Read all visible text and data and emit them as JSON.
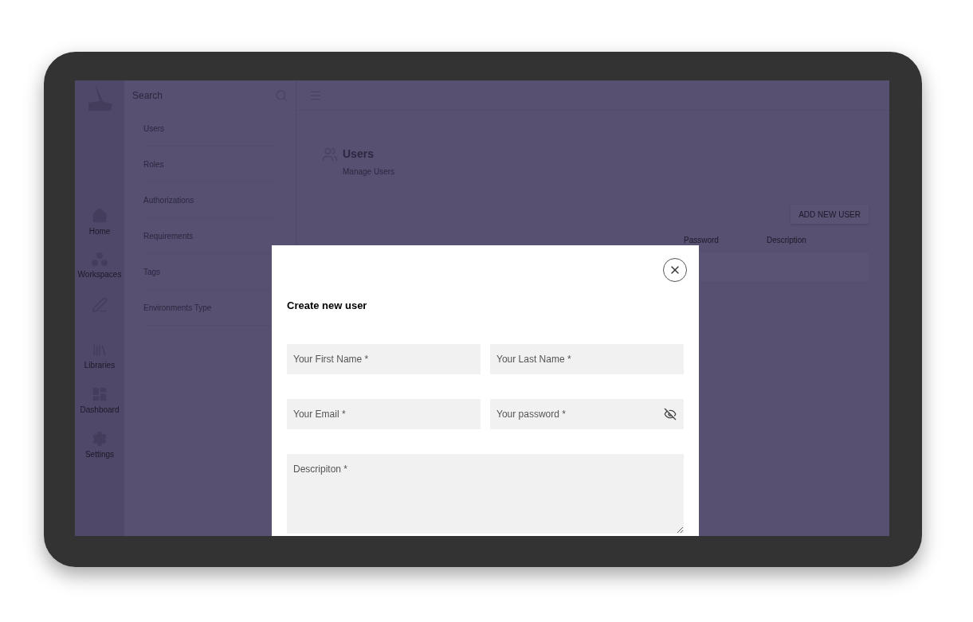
{
  "sidebar": {
    "search": {
      "placeholder": "Search"
    },
    "items": [
      {
        "label": "Users"
      },
      {
        "label": "Roles"
      },
      {
        "label": "Authorizations"
      },
      {
        "label": "Requirements"
      },
      {
        "label": "Tags"
      },
      {
        "label": "Environments Type"
      }
    ]
  },
  "rail": {
    "items": [
      {
        "kind": "home",
        "label": "Home"
      },
      {
        "kind": "workspaces",
        "label": "Workspaces"
      },
      {
        "kind": "edit"
      },
      {
        "kind": "libraries",
        "label": "Libraries"
      },
      {
        "kind": "dashboard",
        "label": "Dashboard"
      },
      {
        "kind": "settings",
        "label": "Settings"
      }
    ]
  },
  "page": {
    "title": "Users",
    "subtitle": "Manage Users",
    "add_button": "ADD NEW USER",
    "columns": [
      "Password",
      "Description"
    ]
  },
  "dialog": {
    "title": "Create new user",
    "fields": [
      {
        "placeholder": "Your First Name *",
        "kind": "text"
      },
      {
        "placeholder": "Your Last Name *",
        "kind": "text"
      },
      {
        "placeholder": "Your Email *",
        "kind": "text"
      },
      {
        "placeholder": "Your password *",
        "kind": "password"
      }
    ],
    "description": {
      "placeholder": "Descripiton *"
    }
  }
}
